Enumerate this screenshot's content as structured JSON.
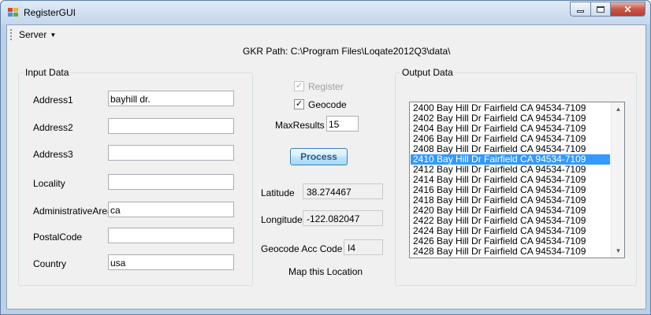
{
  "window": {
    "title": "RegisterGUI",
    "icon": "registergui-app-icon",
    "buttons": {
      "minimize": "minimize-icon",
      "maximize": "maximize-icon",
      "close": "close-icon"
    }
  },
  "menu": {
    "server_label": "Server"
  },
  "gkr_path": "GKR Path: C:\\Program Files\\Loqate2012Q3\\data\\",
  "input_group": {
    "title": "Input Data",
    "fields": [
      {
        "label": "Address1",
        "value": "bayhill dr."
      },
      {
        "label": "Address2",
        "value": ""
      },
      {
        "label": "Address3",
        "value": ""
      },
      {
        "label": "Locality",
        "value": ""
      },
      {
        "label": "AdministrativeArea",
        "value": "ca"
      },
      {
        "label": "PostalCode",
        "value": ""
      },
      {
        "label": "Country",
        "value": "usa"
      }
    ]
  },
  "options": {
    "register_label": "Register",
    "register_checked": true,
    "register_enabled": false,
    "geocode_label": "Geocode",
    "geocode_checked": true,
    "max_results_label": "MaxResults",
    "max_results_value": "15",
    "process_label": "Process"
  },
  "results": {
    "latitude_label": "Latitude",
    "latitude_value": "38.274467",
    "longitude_label": "Longitude",
    "longitude_value": "-122.082047",
    "acc_code_label": "Geocode Acc Code",
    "acc_code_value": "I4",
    "map_label": "Map this Location"
  },
  "output_group": {
    "title": "Output Data",
    "selected_index": 5,
    "items": [
      "2400 Bay Hill Dr Fairfield CA 94534-7109",
      "2402 Bay Hill Dr Fairfield CA 94534-7109",
      "2404 Bay Hill Dr Fairfield CA 94534-7109",
      "2406 Bay Hill Dr Fairfield CA 94534-7109",
      "2408 Bay Hill Dr Fairfield CA 94534-7109",
      "2410 Bay Hill Dr Fairfield CA 94534-7109",
      "2412 Bay Hill Dr Fairfield CA 94534-7109",
      "2414 Bay Hill Dr Fairfield CA 94534-7109",
      "2416 Bay Hill Dr Fairfield CA 94534-7109",
      "2418 Bay Hill Dr Fairfield CA 94534-7109",
      "2420 Bay Hill Dr Fairfield CA 94534-7109",
      "2422 Bay Hill Dr Fairfield CA 94534-7109",
      "2424 Bay Hill Dr Fairfield CA 94534-7109",
      "2426 Bay Hill Dr Fairfield CA 94534-7109",
      "2428 Bay Hill Dr Fairfield CA 94534-7109"
    ]
  }
}
